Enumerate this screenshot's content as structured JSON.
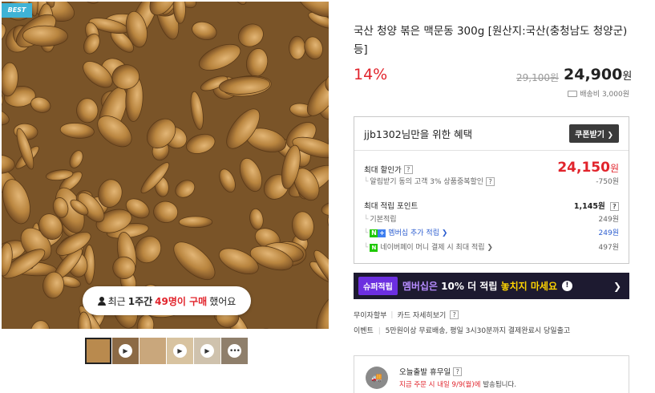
{
  "gallery": {
    "badge": "BEST",
    "purchase_pill": {
      "prefix": "최근",
      "period": "1주간",
      "count": "49명이 구매",
      "suffix": "했어요"
    },
    "thumbnails": [
      {
        "type": "image",
        "active": true
      },
      {
        "type": "video"
      },
      {
        "type": "image"
      },
      {
        "type": "video"
      },
      {
        "type": "video"
      },
      {
        "type": "more"
      }
    ]
  },
  "product": {
    "title": "국산 청양 볶은 맥문동 300g [원산지:국산(충청남도 청양군) 등]",
    "discount": "14%",
    "original_price": "29,100원",
    "sale_price": "24,900",
    "currency": "원",
    "shipping": "배송비 3,000원"
  },
  "benefit": {
    "title": "jjb1302님만을 위한 혜택",
    "coupon_button": "쿠폰받기",
    "max_discount_label": "최대 할인가",
    "max_discount_price": "24,150",
    "max_discount_currency": "원",
    "max_discount_detail": "알림받기 동의 고객 3% 상품중복할인",
    "max_discount_saving": "-750원",
    "points_label": "최대 적립 포인트",
    "points_total": "1,145원",
    "points": [
      {
        "label": "기본적립",
        "value": "249원"
      },
      {
        "label": "멤버십 추가 적립",
        "value": "249원"
      },
      {
        "label": "네이버페이 머니 결제 시 최대 적립",
        "value": "497원"
      }
    ]
  },
  "membership_banner": {
    "badge": "슈퍼적립",
    "text_purple": "멤버십은",
    "text_white": "10% 더 적립",
    "text_yellow": "놓치지 마세요"
  },
  "installment": {
    "label": "무이자할부",
    "link": "카드 자세히보기"
  },
  "event": {
    "label": "이벤트",
    "text": "5만원이상 무료배송, 평일 3시30분까지 결제완료시 당일출고"
  },
  "delivery": {
    "title": "오늘출발 휴무일",
    "desc_red": "지금 주문 시 내일 9/9(월)에",
    "desc_rest": "발송됩니다."
  },
  "colors": {
    "accent_red": "#e1232b",
    "badge_blue": "#3fb3d6",
    "banner_dark": "#1d1a30",
    "naver_green": "#1ec800"
  }
}
